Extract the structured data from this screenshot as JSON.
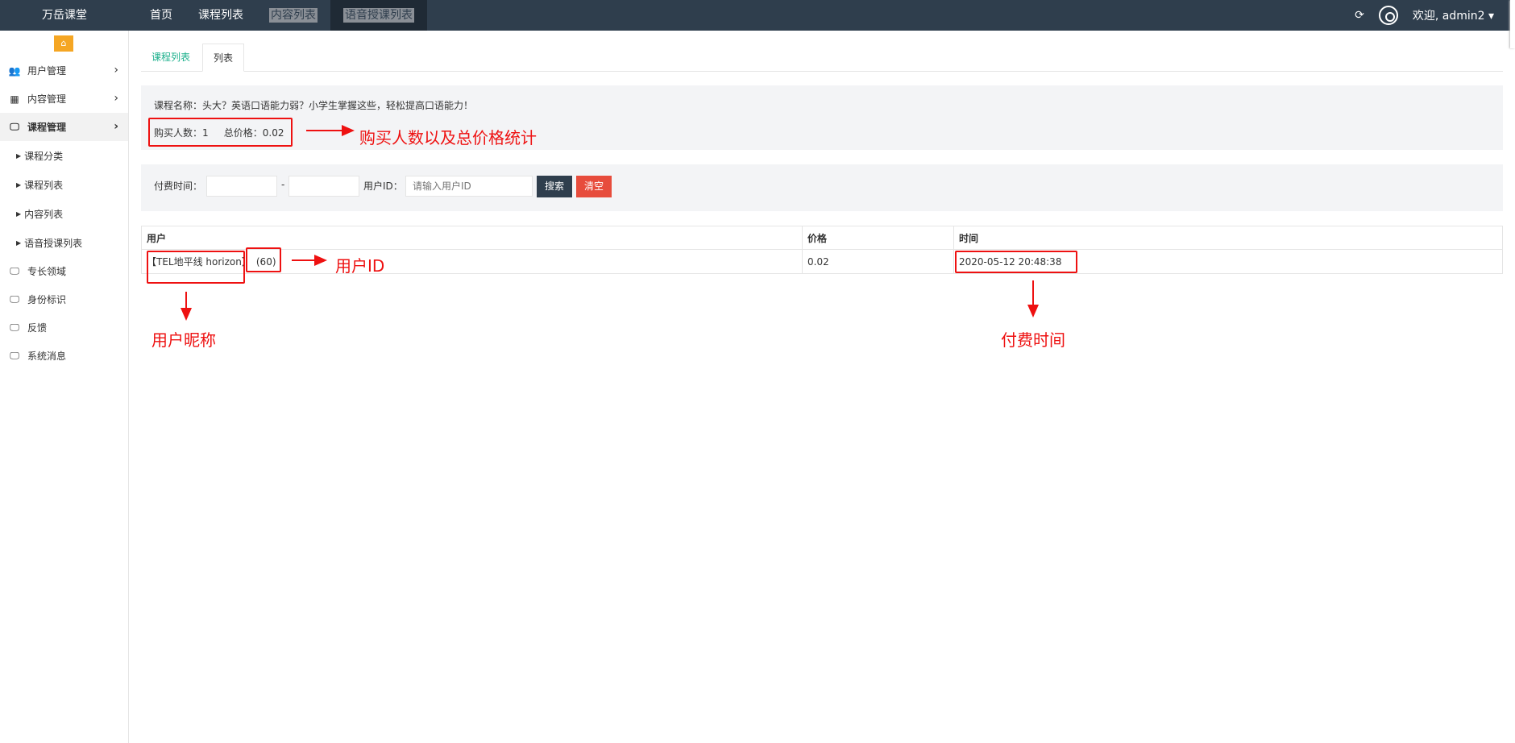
{
  "app": {
    "brand": "万岳课堂"
  },
  "topnav": {
    "items": [
      "首页",
      "课程列表",
      "内容列表",
      "语音授课列表"
    ]
  },
  "user": {
    "welcome": "欢迎, admin2 ▾"
  },
  "sidebar": {
    "items": [
      {
        "label": "用户管理",
        "icon": "users-icon"
      },
      {
        "label": "内容管理",
        "icon": "grid-icon"
      },
      {
        "label": "课程管理",
        "icon": "monitor-icon"
      }
    ],
    "subitems": [
      "课程分类",
      "课程列表",
      "内容列表",
      "语音授课列表"
    ],
    "more_items": [
      {
        "label": "专长领域",
        "icon": "monitor-icon"
      },
      {
        "label": "身份标识",
        "icon": "monitor-icon"
      },
      {
        "label": "反馈",
        "icon": "monitor-icon"
      },
      {
        "label": "系统消息",
        "icon": "monitor-icon"
      }
    ]
  },
  "tabs": {
    "link": "课程列表",
    "current": "列表"
  },
  "info": {
    "course_name": "课程名称：头大？英语口语能力弱？小学生掌握这些，轻松提高口语能力！",
    "buyers_label": "购买人数：",
    "buyers": "1",
    "total_label": "总价格：",
    "total": "0.02"
  },
  "filter": {
    "time_label": "付费时间：",
    "dash": "-",
    "uid_label": "用户ID：",
    "uid_placeholder": "请输入用户ID",
    "search": "搜索",
    "clear": "清空"
  },
  "table": {
    "headers": [
      "用户",
      "价格",
      "时间"
    ],
    "rows": [
      {
        "nickname": "【TEL地平线 horizon】",
        "uid": "(60)",
        "price": "0.02",
        "time": "2020-05-12 20:48:38"
      }
    ]
  },
  "annotations": {
    "stats": "购买人数以及总价格统计",
    "uid": "用户ID",
    "nickname": "用户昵称",
    "time": "付费时间"
  },
  "colors": {
    "topbar": "#2f3e4d",
    "accent": "#1aaf8b",
    "annotation": "#ee1111",
    "home": "#f5a623"
  }
}
